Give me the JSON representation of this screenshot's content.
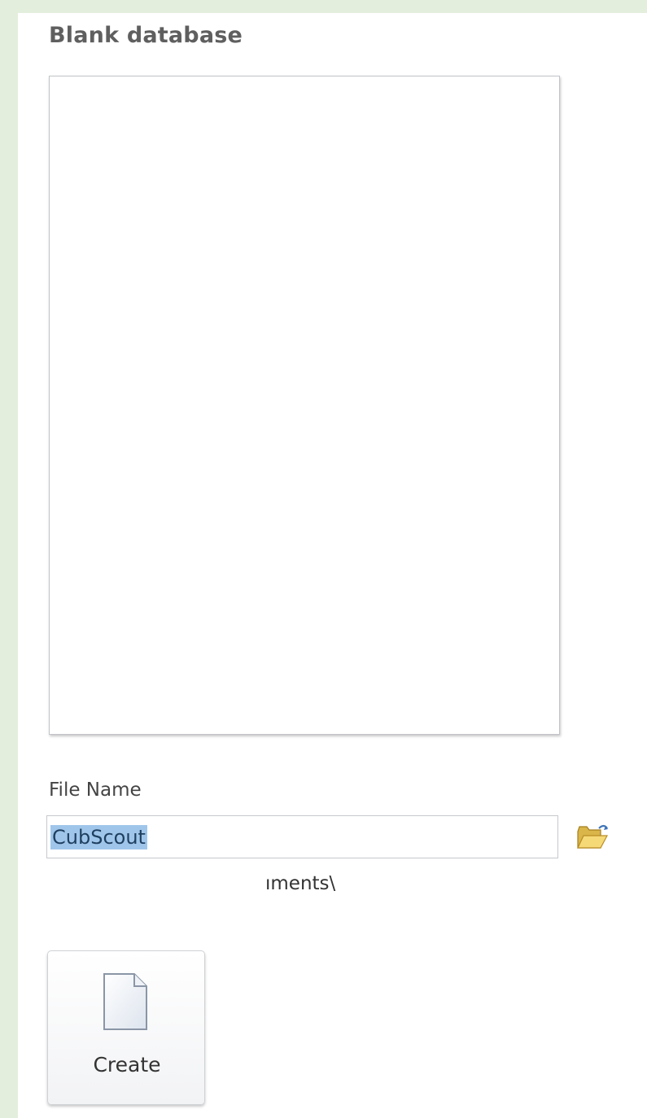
{
  "panel": {
    "title": "Blank database",
    "file_name_label": "File Name",
    "file_name_value": "CubScout",
    "path_fragment": "ıments\\",
    "create_label": "Create"
  },
  "icons": {
    "browse": "folder-open-icon",
    "create": "blank-document-icon"
  },
  "colors": {
    "frame_green": "#e3efdc",
    "selection_highlight": "#9fc6ea",
    "title_gray": "#5f5f5f"
  }
}
